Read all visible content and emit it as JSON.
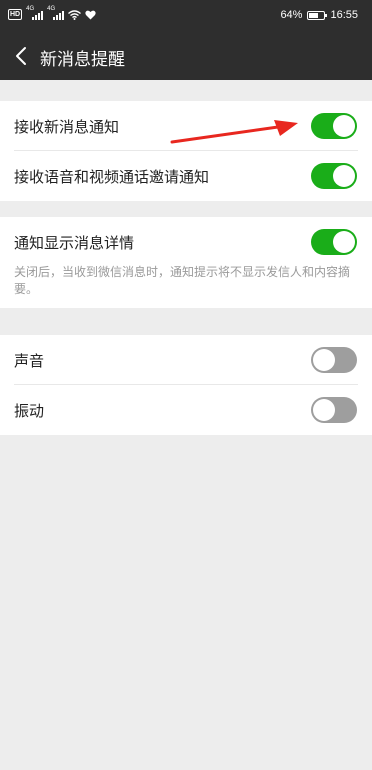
{
  "status_bar": {
    "hd": "HD",
    "signal1_label": "4G",
    "signal2_label": "4G",
    "battery_text": "64%",
    "battery_level": 0.64,
    "time": "16:55",
    "icons": [
      "wifi-icon",
      "heart-icon"
    ]
  },
  "nav": {
    "title": "新消息提醒",
    "back_icon": "chevron-left-icon"
  },
  "group1": [
    {
      "label": "接收新消息通知",
      "state": "on"
    },
    {
      "label": "接收语音和视频通话邀请通知",
      "state": "on"
    }
  ],
  "group2": {
    "label": "通知显示消息详情",
    "state": "on",
    "note": "关闭后，当收到微信消息时，通知提示将不显示发信人和内容摘要。"
  },
  "group3": [
    {
      "label": "声音",
      "state": "off"
    },
    {
      "label": "振动",
      "state": "off"
    }
  ],
  "colors": {
    "bar_bg": "#2e2e2e",
    "page_bg": "#ededed",
    "toggle_on": "#1aad19",
    "toggle_off": "#9e9e9e",
    "annotation_arrow": "#e8271f"
  }
}
